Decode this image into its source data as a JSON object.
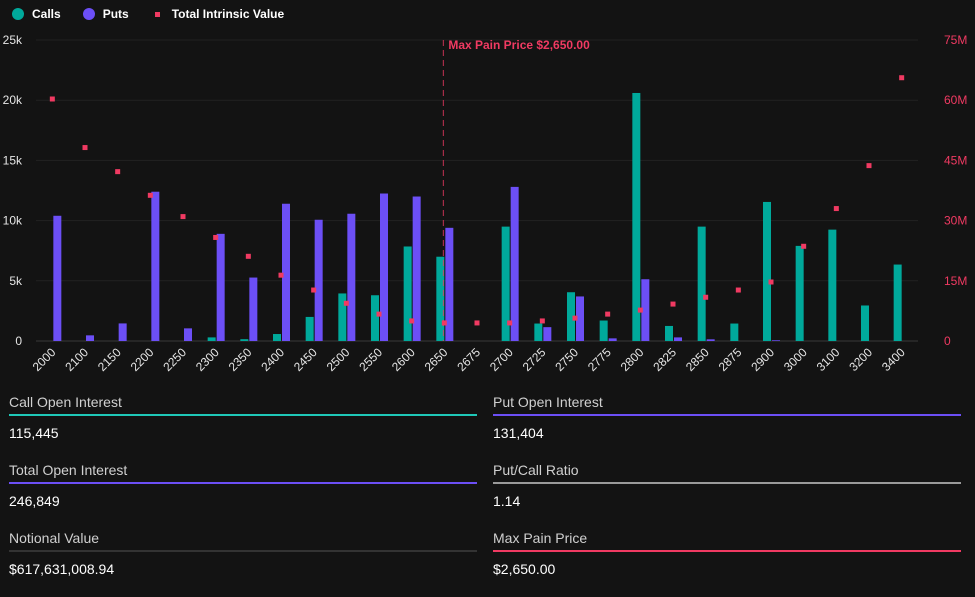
{
  "legend": {
    "calls": "Calls",
    "puts": "Puts",
    "intrinsic": "Total Intrinsic Value"
  },
  "colors": {
    "calls": "#00a99b",
    "puts": "#6c4ff6",
    "intrinsic": "#f03a62",
    "neutral": "#9a9a9a",
    "dark": "#333333"
  },
  "chart_data": {
    "type": "bar",
    "categories": [
      "2000",
      "2100",
      "2150",
      "2200",
      "2250",
      "2300",
      "2350",
      "2400",
      "2450",
      "2500",
      "2550",
      "2600",
      "2650",
      "2675",
      "2700",
      "2725",
      "2750",
      "2775",
      "2800",
      "2825",
      "2850",
      "2875",
      "2900",
      "3000",
      "3100",
      "3200",
      "3400"
    ],
    "series": [
      {
        "name": "Calls",
        "axis": "left",
        "values": [
          0,
          0,
          0,
          0,
          0,
          0.3,
          0.15,
          0.58,
          2.0,
          3.95,
          3.8,
          7.85,
          7.0,
          0,
          9.5,
          1.45,
          4.05,
          1.7,
          20.6,
          1.25,
          9.5,
          1.45,
          11.55,
          7.9,
          9.25,
          2.95,
          6.35
        ]
      },
      {
        "name": "Puts",
        "axis": "left",
        "values": [
          10.4,
          0.47,
          1.46,
          12.4,
          1.05,
          8.9,
          5.27,
          11.4,
          10.07,
          10.57,
          12.25,
          12.0,
          9.4,
          0,
          12.8,
          1.15,
          3.7,
          0.22,
          5.13,
          0.3,
          0.14,
          0,
          0.06,
          0,
          0,
          0,
          0
        ]
      },
      {
        "name": "Total Intrinsic Value",
        "axis": "right",
        "type": "scatter",
        "values": [
          60.3,
          48.2,
          42.2,
          36.3,
          31.0,
          25.8,
          21.1,
          16.4,
          12.7,
          9.4,
          6.7,
          5.0,
          4.5,
          4.5,
          4.5,
          5.0,
          5.7,
          6.7,
          7.7,
          9.2,
          10.9,
          12.7,
          14.7,
          23.6,
          33.0,
          43.7,
          65.6
        ]
      }
    ],
    "y_left": {
      "unit": "k",
      "ylim": [
        0,
        25
      ],
      "ticks": [
        "0",
        "5k",
        "10k",
        "15k",
        "20k",
        "25k"
      ]
    },
    "y_right": {
      "unit": "M",
      "ylim": [
        0,
        75
      ],
      "ticks": [
        "0",
        "15M",
        "30M",
        "45M",
        "60M",
        "75M"
      ]
    },
    "annotation": {
      "category": "2650",
      "label": "Max Pain Price $2,650.00"
    },
    "grid": true,
    "legend_position": "top-left"
  },
  "stats": [
    {
      "label": "Call Open Interest",
      "value": "115,445",
      "color": "#1fc8b8"
    },
    {
      "label": "Put Open Interest",
      "value": "131,404",
      "color": "#6c4ff6"
    },
    {
      "label": "Total Open Interest",
      "value": "246,849",
      "color": "#6c4ff6"
    },
    {
      "label": "Put/Call Ratio",
      "value": "1.14",
      "color": "#9a9a9a"
    },
    {
      "label": "Notional Value",
      "value": "$617,631,008.94",
      "color": "#333333"
    },
    {
      "label": "Max Pain Price",
      "value": "$2,650.00",
      "color": "#f03a62"
    }
  ]
}
